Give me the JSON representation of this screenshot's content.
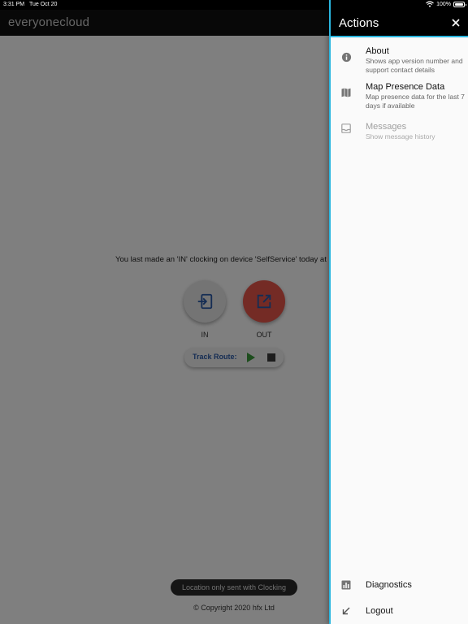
{
  "status_bar": {
    "time": "3:31 PM",
    "date": "Tue Oct 20",
    "battery": "100%"
  },
  "app": {
    "title": "everyonecloud",
    "last_clocking": "You last made an 'IN' clocking on device 'SelfService' today at",
    "in_label": "IN",
    "out_label": "OUT",
    "track_route_label": "Track Route:",
    "location_toast": "Location only sent with Clocking",
    "copyright": "© Copyright 2020 hfx Ltd"
  },
  "drawer": {
    "title": "Actions",
    "items": [
      {
        "title": "About",
        "subtitle": "Shows app version number and support contact details",
        "icon": "info-icon"
      },
      {
        "title": "Map Presence Data",
        "subtitle": "Map presence data for the last 7 days if available",
        "icon": "map-icon"
      },
      {
        "title": "Messages",
        "subtitle": "Show message history",
        "icon": "inbox-icon"
      }
    ],
    "bottom_items": [
      {
        "title": "Diagnostics",
        "icon": "bar-chart-icon"
      },
      {
        "title": "Logout",
        "icon": "arrow-down-left-icon"
      }
    ]
  },
  "colors": {
    "accent": "#2ab7e0",
    "out_button": "#e8564a",
    "in_icon": "#2a5aa8",
    "play": "#3a9a3a"
  }
}
